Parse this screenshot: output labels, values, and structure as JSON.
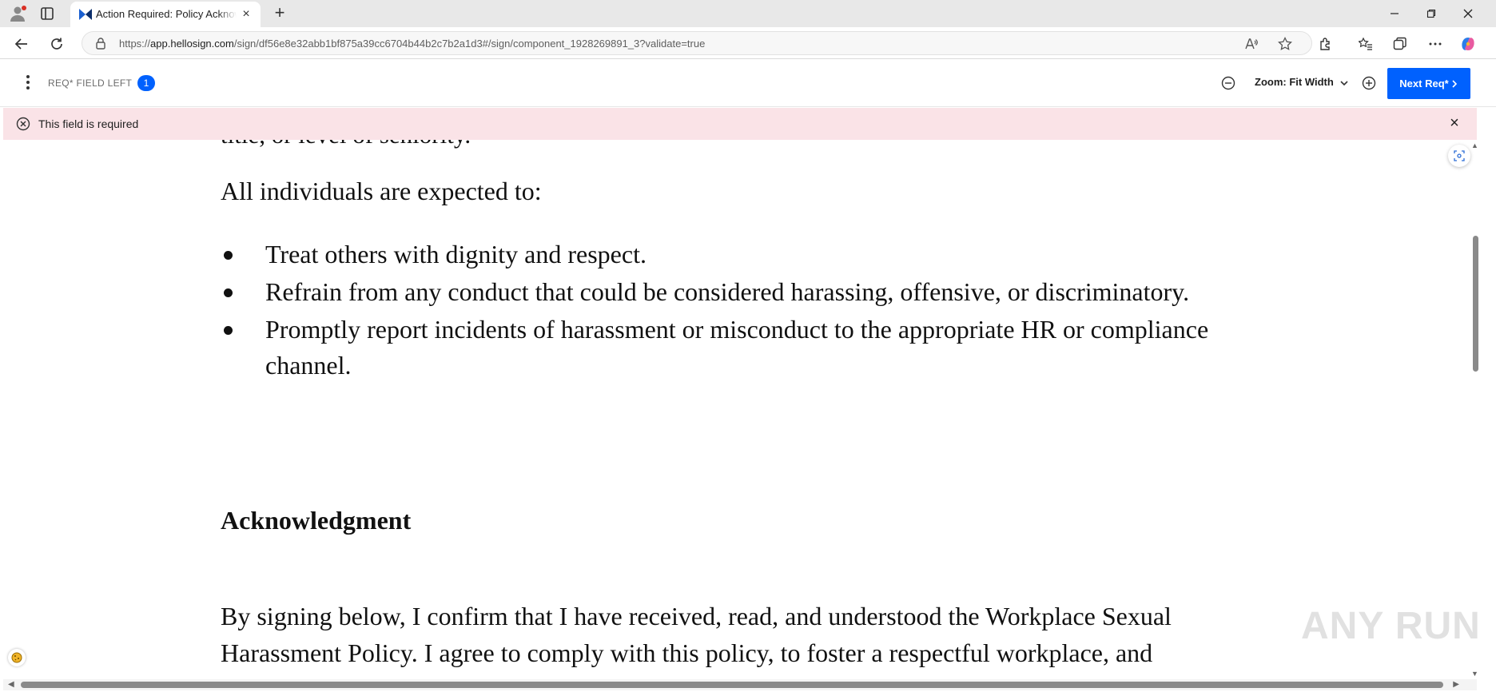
{
  "browser": {
    "tab_title": "Action Required: Policy Acknowledgment",
    "url_prefix": "https://",
    "url_host": "app.hellosign.com",
    "url_path": "/sign/df56e8e32abb1bf875a39cc6704b44b2c7b2a1d3#/sign/component_1928269891_3?validate=true",
    "new_tab_label": "+",
    "close_tab_label": "×"
  },
  "toolbar": {
    "req_label": "REQ* FIELD LEFT",
    "req_count": "1",
    "zoom_label": "Zoom: Fit Width",
    "next_label": "Next Req*"
  },
  "banner": {
    "message": "This field is required",
    "close_label": "×"
  },
  "document": {
    "cut_line": "title, or level of seniority.",
    "intro": "All individuals are expected to:",
    "bullets": [
      "Treat others with dignity and respect.",
      "Refrain from any conduct that could be considered harassing, offensive, or discriminatory.",
      "Promptly report incidents of harassment or misconduct to the appropriate HR or compliance channel."
    ],
    "heading": "Acknowledgment",
    "sign_text": "By signing below, I confirm that I have received, read, and understood the Workplace Sexual Harassment Policy. I agree to comply with this policy, to foster a respectful workplace, and"
  },
  "watermark": "ANY RUN",
  "colors": {
    "accent": "#0061fe",
    "banner_bg": "#fae3e7"
  }
}
